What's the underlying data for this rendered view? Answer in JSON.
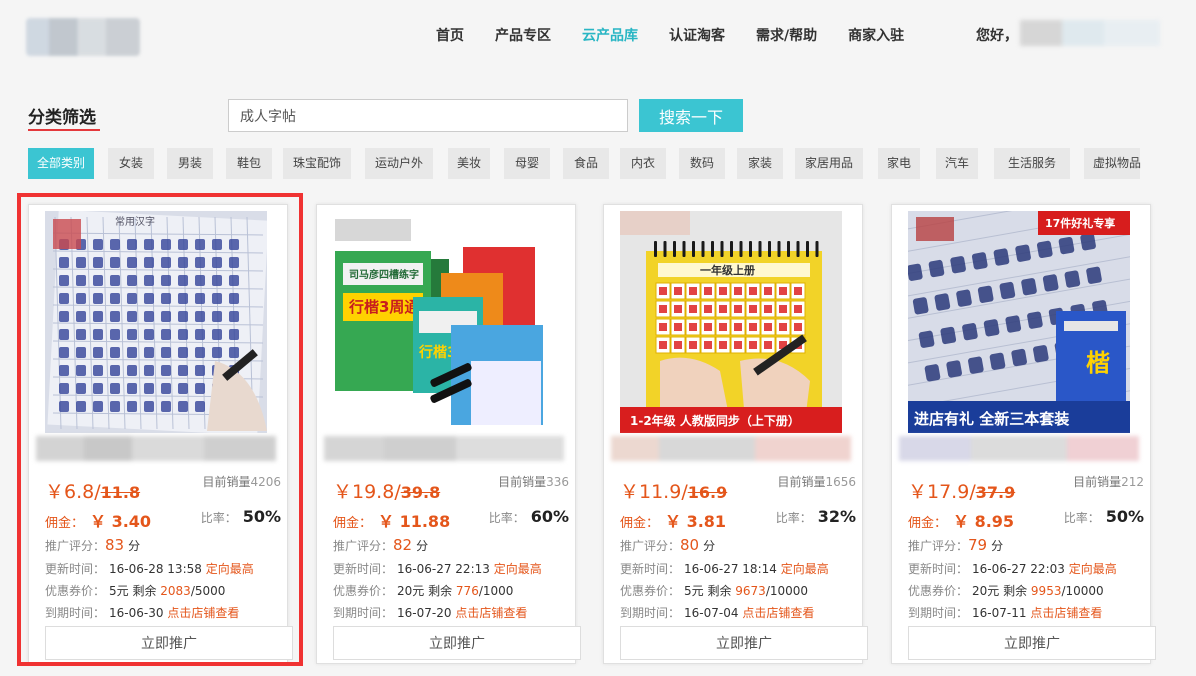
{
  "nav": {
    "items": [
      "首页",
      "产品专区",
      "云产品库",
      "认证淘客",
      "需求/帮助",
      "商家入驻"
    ],
    "active_index": 2,
    "greeting": "您好，"
  },
  "filter": {
    "title": "分类筛选",
    "search_value": "成人字帖",
    "search_button": "搜索一下"
  },
  "categories": [
    "全部类别",
    "女装",
    "男装",
    "鞋包",
    "珠宝配饰",
    "运动户外",
    "美妆",
    "母婴",
    "食品",
    "内衣",
    "数码",
    "家装",
    "家居用品",
    "家电",
    "汽车",
    "生活服务",
    "虚拟物品"
  ],
  "labels": {
    "sales": "目前销量",
    "commission": "佣金：",
    "ratio": "比率：",
    "score": "推广评分：",
    "score_unit": "分",
    "update": "更新时间：",
    "targeted": "定向最高",
    "coupon": "优惠券价：",
    "remain": "剩余",
    "expire": "到期时间：",
    "shop": "点击店铺查看",
    "promote": "立即推广",
    "currency": "￥"
  },
  "products": [
    {
      "price": "6.8",
      "old_price": "11.8",
      "sales": "4206",
      "commission": "3.40",
      "ratio": "50%",
      "score": "83",
      "updated": "16-06-28 13:58",
      "coupon": "5元",
      "remain": "2083",
      "total": "5000",
      "expire": "16-06-30",
      "selected": true
    },
    {
      "price": "19.8",
      "old_price": "39.8",
      "sales": "336",
      "commission": "11.88",
      "ratio": "60%",
      "score": "82",
      "updated": "16-06-27 22:13",
      "coupon": "20元",
      "remain": "776",
      "total": "1000",
      "expire": "16-07-20",
      "selected": false
    },
    {
      "price": "11.9",
      "old_price": "16.9",
      "sales": "1656",
      "commission": "3.81",
      "ratio": "32%",
      "score": "80",
      "updated": "16-06-27 18:14",
      "coupon": "5元",
      "remain": "9673",
      "total": "10000",
      "expire": "16-07-04",
      "selected": false
    },
    {
      "price": "17.9",
      "old_price": "37.9",
      "sales": "212",
      "commission": "8.95",
      "ratio": "50%",
      "score": "79",
      "updated": "16-06-27 22:03",
      "coupon": "20元",
      "remain": "9953",
      "total": "10000",
      "expire": "16-07-11",
      "selected": false
    }
  ],
  "images": {
    "p1": {
      "heading": "常用汉字"
    },
    "p2": {
      "brand": "司马彦四槽练字",
      "series": "行楷3周通"
    },
    "p3": {
      "heading": "一年级上册",
      "banner": "1-2年级  人教版同步（上下册）"
    },
    "p4": {
      "badge": "17件好礼专享",
      "banner": "进店有礼  全新三本套装"
    }
  },
  "colors": {
    "accent": "#29b6c4",
    "price": "#e4561b",
    "selected_border": "#f03232"
  }
}
